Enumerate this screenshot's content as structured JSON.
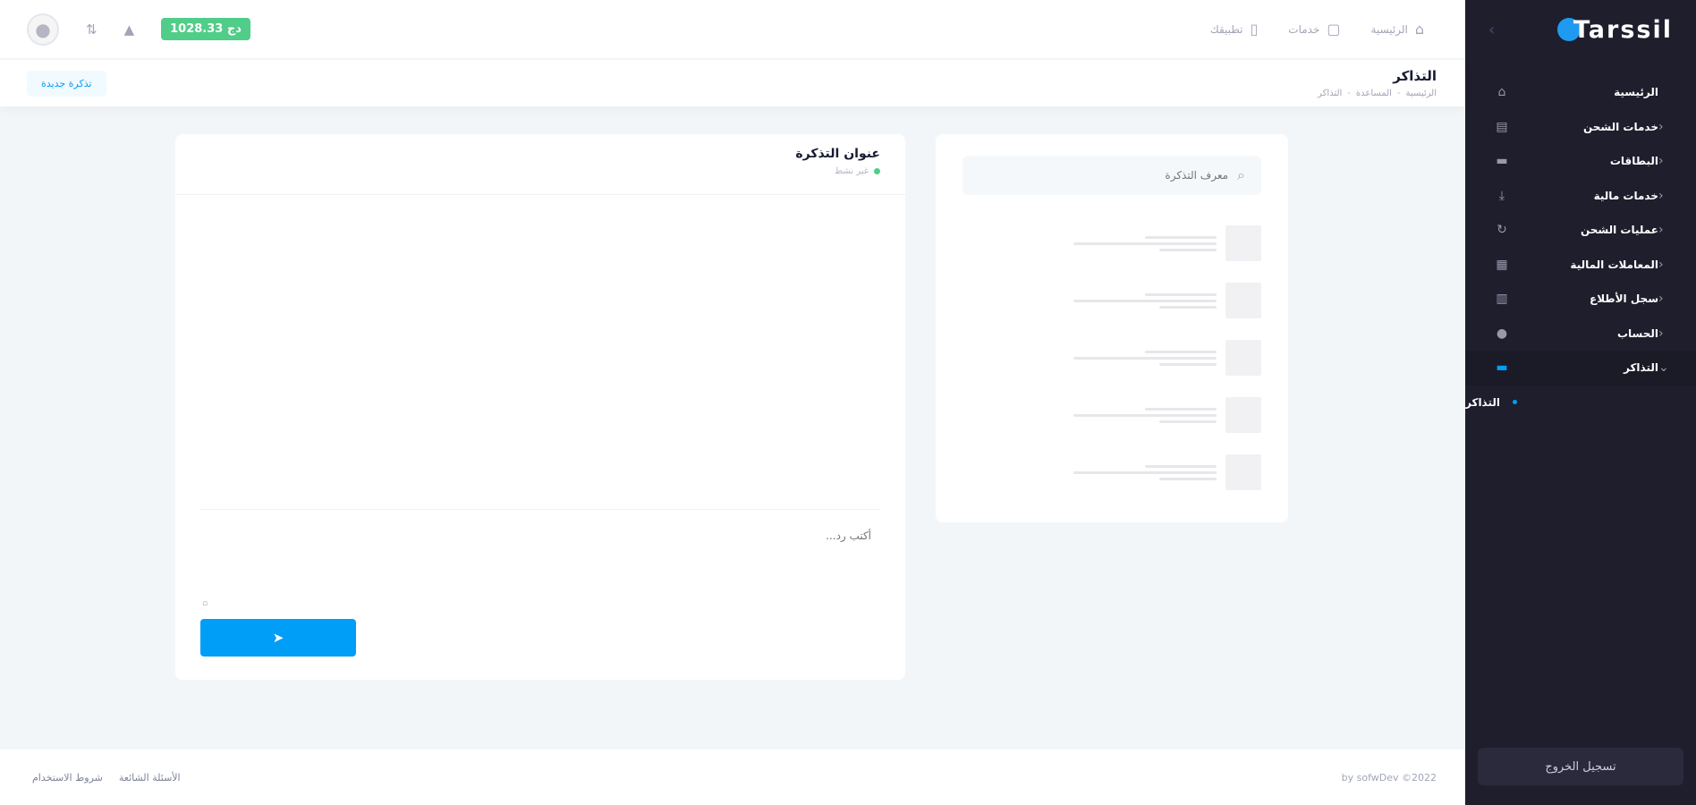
{
  "brand": {
    "logo_text": "Tarssil"
  },
  "header": {
    "balance": "1028.33 دج",
    "nav": [
      {
        "label": "الرئيسية",
        "icon": "home-icon"
      },
      {
        "label": "خدمات",
        "icon": "bag-icon"
      },
      {
        "label": "تطبيقك",
        "icon": "phone-icon"
      }
    ]
  },
  "toolbar": {
    "title": "التذاكر",
    "breadcrumb": [
      "الرئيسية",
      "المساعدة",
      "التذاكر"
    ],
    "new_ticket": "تذكرة جديدة"
  },
  "sidebar": {
    "items": [
      {
        "label": "الرئيسية",
        "icon": "home-icon",
        "has_arrow": false
      },
      {
        "label": "خدمات الشحن",
        "icon": "charge-icon",
        "has_arrow": true
      },
      {
        "label": "البطاقات",
        "icon": "card-icon",
        "has_arrow": true
      },
      {
        "label": "خدمات مالية",
        "icon": "download-icon",
        "has_arrow": true
      },
      {
        "label": "عمليات الشحن",
        "icon": "phone-charge-icon",
        "has_arrow": true
      },
      {
        "label": "المعاملات المالية",
        "icon": "table-icon",
        "has_arrow": true
      },
      {
        "label": "سجل الأطلاع",
        "icon": "document-icon",
        "has_arrow": true
      },
      {
        "label": "الحساب",
        "icon": "user-icon",
        "has_arrow": true
      },
      {
        "label": "التذاكر",
        "icon": "ticket-icon",
        "has_arrow": true,
        "open": true
      }
    ],
    "sub_item": "التذاكر",
    "logout": "تسجيل الخروج"
  },
  "list": {
    "search_placeholder": "معرف التذكرة"
  },
  "chat": {
    "title": "عنوان التذكرة",
    "status": "غير نشط",
    "reply_placeholder": "أكتب رد..."
  },
  "footer": {
    "copyright": "2022© by sofwDev",
    "links": [
      "الأسئلة الشائعة",
      "شروط الاستخدام"
    ]
  },
  "colors": {
    "accent": "#009ef7",
    "balance": "#50cd89",
    "sidebar": "#1e1e2d"
  }
}
